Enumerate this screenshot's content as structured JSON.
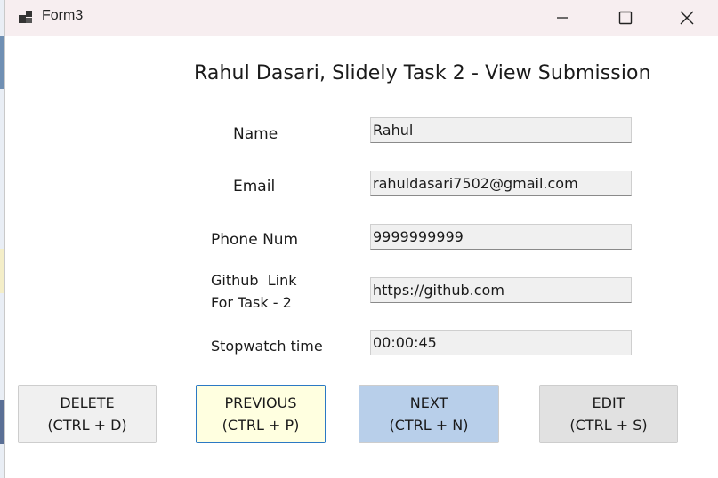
{
  "window": {
    "title": "Form3"
  },
  "form": {
    "heading": "Rahul Dasari, Slidely Task 2 - View Submission",
    "fields": {
      "name": {
        "label": "Name",
        "value": "Rahul"
      },
      "email": {
        "label": "Email",
        "value": "rahuldasari7502@gmail.com"
      },
      "phone": {
        "label": "Phone Num",
        "value": "9999999999"
      },
      "github": {
        "label_line1": "Github  Link",
        "label_line2": "For Task - 2",
        "value": "https://github.com"
      },
      "stopwatch": {
        "label": "Stopwatch time",
        "value": "00:00:45"
      }
    }
  },
  "buttons": {
    "delete": {
      "line1": "DELETE",
      "line2": "(CTRL + D)"
    },
    "previous": {
      "line1": "PREVIOUS",
      "line2": "(CTRL + P)"
    },
    "next": {
      "line1": "NEXT",
      "line2": "(CTRL + N)"
    },
    "edit": {
      "line1": "EDIT",
      "line2": "(CTRL + S)"
    }
  },
  "icons": {
    "app": "app-icon",
    "minimize": "minimize-icon",
    "maximize": "maximize-icon",
    "close": "close-icon"
  },
  "colors": {
    "titlebar": "#f7eef0",
    "previous_button": "#ffffe0",
    "next_button": "#b8cfea",
    "field_bg": "#f0f0f0"
  }
}
